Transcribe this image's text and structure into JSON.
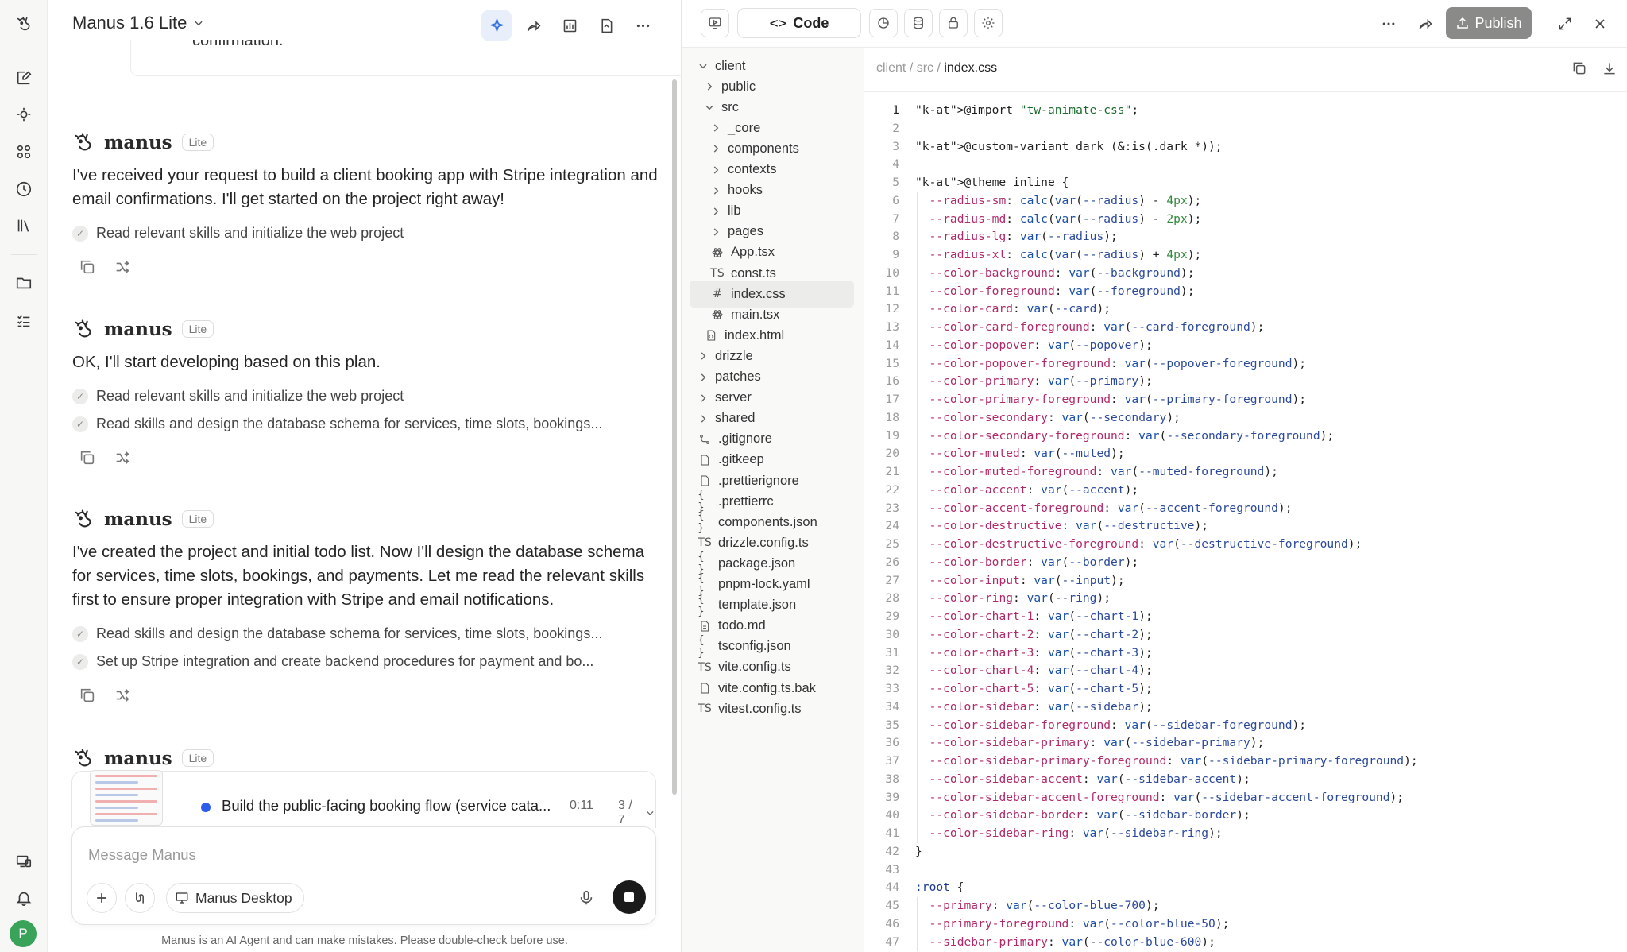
{
  "chat": {
    "app_title": "Manus 1.6 Lite",
    "previous_tail": "confirmation.",
    "messages": [
      {
        "brand": "manus",
        "badge": "Lite",
        "text": "I've received your request to build a client booking app with Stripe integration and email confirmations. I'll get started on the project right away!",
        "steps": [
          "Read relevant skills and initialize the web project"
        ]
      },
      {
        "brand": "manus",
        "badge": "Lite",
        "text": "OK, I'll start developing based on this plan.",
        "steps": [
          "Read relevant skills and initialize the web project",
          "Read skills and design the database schema for services, time slots, bookings..."
        ]
      },
      {
        "brand": "manus",
        "badge": "Lite",
        "text": "I've created the project and initial todo list. Now I'll design the database schema for services, time slots, bookings, and payments. Let me read the relevant skills first to ensure proper integration with Stripe and email notifications.",
        "steps": [
          "Read skills and design the database schema for services, time slots, bookings...",
          "Set up Stripe integration and create backend procedures for payment and bo..."
        ]
      },
      {
        "brand": "manus",
        "badge": "Lite"
      }
    ],
    "task": {
      "title": "Build the public-facing booking flow (service cata...",
      "time": "0:11",
      "progress": "3 / 7"
    },
    "input": {
      "placeholder": "Message Manus",
      "device_chip": "Manus Desktop"
    },
    "disclaimer": "Manus is an AI Agent and can make mistakes. Please double-check before use."
  },
  "panel": {
    "code_tab": "Code",
    "publish_label": "Publish",
    "breadcrumb": [
      "client",
      "src",
      "index.css"
    ],
    "tree": [
      {
        "label": "client",
        "type": "folder-open",
        "depth": 0
      },
      {
        "label": "public",
        "type": "folder",
        "depth": 1
      },
      {
        "label": "src",
        "type": "folder-open",
        "depth": 1
      },
      {
        "label": "_core",
        "type": "folder",
        "depth": 2
      },
      {
        "label": "components",
        "type": "folder",
        "depth": 2
      },
      {
        "label": "contexts",
        "type": "folder",
        "depth": 2
      },
      {
        "label": "hooks",
        "type": "folder",
        "depth": 2
      },
      {
        "label": "lib",
        "type": "folder",
        "depth": 2
      },
      {
        "label": "pages",
        "type": "folder",
        "depth": 2
      },
      {
        "label": "App.tsx",
        "type": "react",
        "depth": 2
      },
      {
        "label": "const.ts",
        "type": "ts",
        "depth": 2
      },
      {
        "label": "index.css",
        "type": "css",
        "depth": 2,
        "selected": true
      },
      {
        "label": "main.tsx",
        "type": "react",
        "depth": 2
      },
      {
        "label": "index.html",
        "type": "html",
        "depth": 1
      },
      {
        "label": "drizzle",
        "type": "folder",
        "depth": 0
      },
      {
        "label": "patches",
        "type": "folder",
        "depth": 0
      },
      {
        "label": "server",
        "type": "folder",
        "depth": 0
      },
      {
        "label": "shared",
        "type": "folder",
        "depth": 0
      },
      {
        "label": ".gitignore",
        "type": "git",
        "depth": 0
      },
      {
        "label": ".gitkeep",
        "type": "file",
        "depth": 0
      },
      {
        "label": ".prettierignore",
        "type": "file",
        "depth": 0
      },
      {
        "label": ".prettierrc",
        "type": "json",
        "depth": 0
      },
      {
        "label": "components.json",
        "type": "json",
        "depth": 0
      },
      {
        "label": "drizzle.config.ts",
        "type": "ts",
        "depth": 0
      },
      {
        "label": "package.json",
        "type": "json",
        "depth": 0
      },
      {
        "label": "pnpm-lock.yaml",
        "type": "json",
        "depth": 0
      },
      {
        "label": "template.json",
        "type": "json",
        "depth": 0
      },
      {
        "label": "todo.md",
        "type": "md",
        "depth": 0
      },
      {
        "label": "tsconfig.json",
        "type": "json",
        "depth": 0
      },
      {
        "label": "vite.config.ts",
        "type": "ts",
        "depth": 0
      },
      {
        "label": "vite.config.ts.bak",
        "type": "file",
        "depth": 0
      },
      {
        "label": "vitest.config.ts",
        "type": "ts",
        "depth": 0
      }
    ],
    "code_lines": [
      "@import \"tw-animate-css\";",
      "",
      "@custom-variant dark (&:is(.dark *));",
      "",
      "@theme inline {",
      "  --radius-sm: calc(var(--radius) - 4px);",
      "  --radius-md: calc(var(--radius) - 2px);",
      "  --radius-lg: var(--radius);",
      "  --radius-xl: calc(var(--radius) + 4px);",
      "  --color-background: var(--background);",
      "  --color-foreground: var(--foreground);",
      "  --color-card: var(--card);",
      "  --color-card-foreground: var(--card-foreground);",
      "  --color-popover: var(--popover);",
      "  --color-popover-foreground: var(--popover-foreground);",
      "  --color-primary: var(--primary);",
      "  --color-primary-foreground: var(--primary-foreground);",
      "  --color-secondary: var(--secondary);",
      "  --color-secondary-foreground: var(--secondary-foreground);",
      "  --color-muted: var(--muted);",
      "  --color-muted-foreground: var(--muted-foreground);",
      "  --color-accent: var(--accent);",
      "  --color-accent-foreground: var(--accent-foreground);",
      "  --color-destructive: var(--destructive);",
      "  --color-destructive-foreground: var(--destructive-foreground);",
      "  --color-border: var(--border);",
      "  --color-input: var(--input);",
      "  --color-ring: var(--ring);",
      "  --color-chart-1: var(--chart-1);",
      "  --color-chart-2: var(--chart-2);",
      "  --color-chart-3: var(--chart-3);",
      "  --color-chart-4: var(--chart-4);",
      "  --color-chart-5: var(--chart-5);",
      "  --color-sidebar: var(--sidebar);",
      "  --color-sidebar-foreground: var(--sidebar-foreground);",
      "  --color-sidebar-primary: var(--sidebar-primary);",
      "  --color-sidebar-primary-foreground: var(--sidebar-primary-foreground);",
      "  --color-sidebar-accent: var(--sidebar-accent);",
      "  --color-sidebar-accent-foreground: var(--sidebar-accent-foreground);",
      "  --color-sidebar-border: var(--sidebar-border);",
      "  --color-sidebar-ring: var(--sidebar-ring);",
      "}",
      "",
      ":root {",
      "  --primary: var(--color-blue-700);",
      "  --primary-foreground: var(--color-blue-50);",
      "  --sidebar-primary: var(--color-blue-600);"
    ],
    "current_line": 1
  },
  "user": {
    "avatar_initial": "P",
    "avatar_color": "#3aa35a"
  },
  "colors": {
    "accent": "#2f6fe0",
    "task_dot": "#2f5bea",
    "publish_bg": "#8a8a88"
  }
}
